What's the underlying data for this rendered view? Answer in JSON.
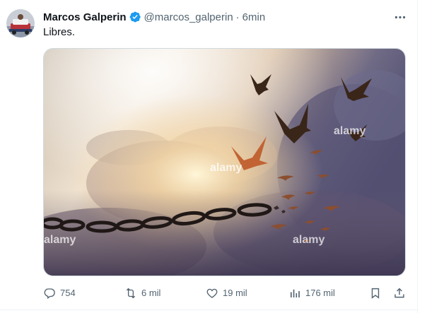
{
  "tweet": {
    "author": {
      "display_name": "Marcos Galperin",
      "handle": "@marcos_galperin",
      "verified": true
    },
    "separator": "·",
    "time": "6min",
    "text": "Libres.",
    "media": {
      "watermark": "alamy"
    },
    "actions": {
      "replies": "754",
      "retweets": "6 mil",
      "likes": "19 mil",
      "views": "176 mil"
    }
  },
  "colors": {
    "text_primary": "#0f1419",
    "text_secondary": "#536471",
    "verified_blue": "#1d9bf0",
    "border": "#cfd9de"
  },
  "icons": {
    "more": "more-horizontal-icon",
    "reply": "reply-icon",
    "retweet": "retweet-icon",
    "like": "heart-icon",
    "views": "analytics-icon",
    "bookmark": "bookmark-icon",
    "share": "share-icon",
    "verified": "verified-badge-icon"
  }
}
